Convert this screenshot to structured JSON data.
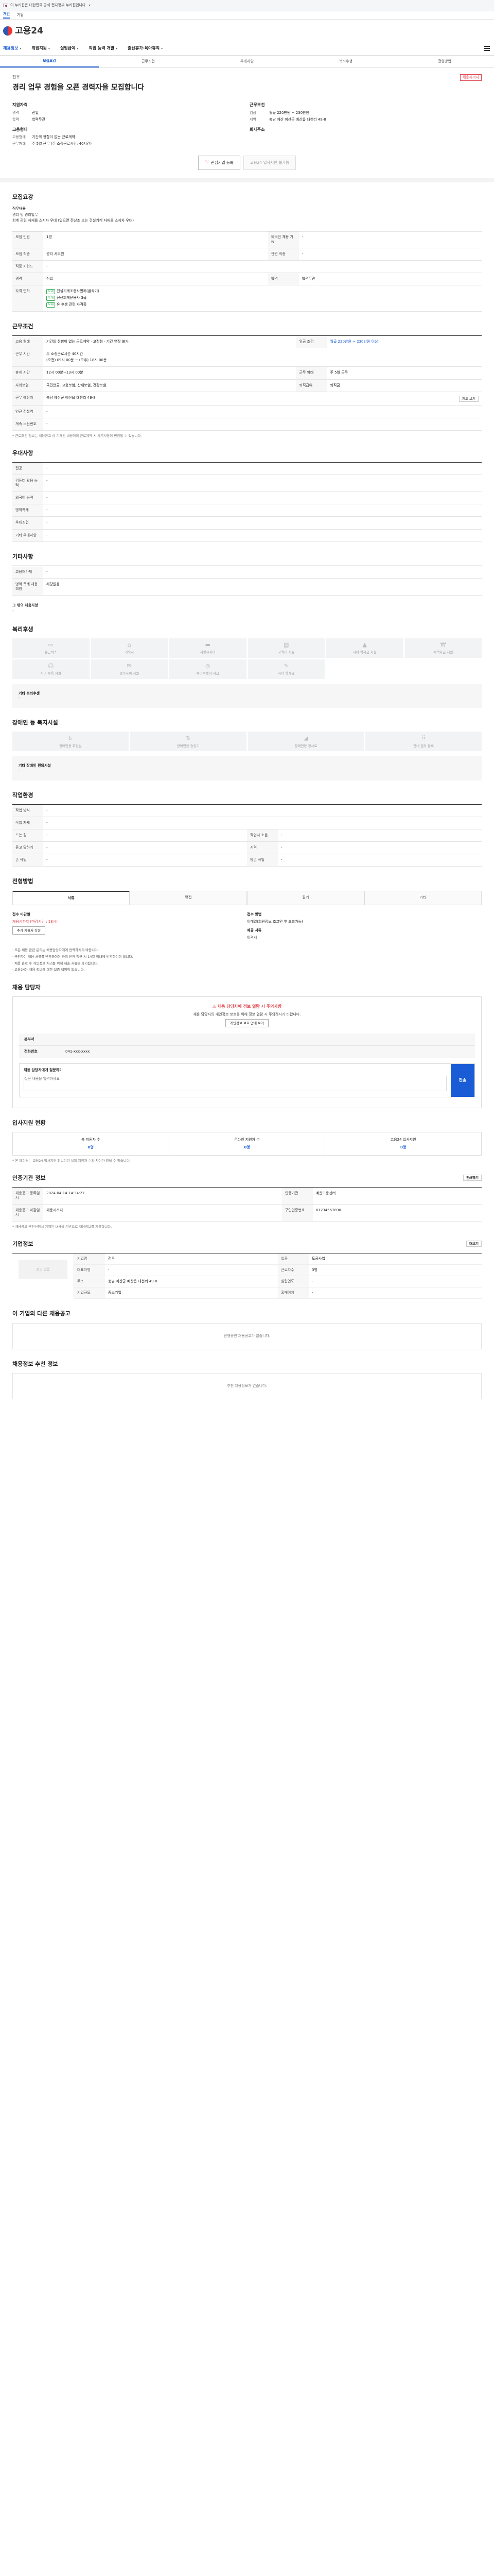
{
  "gov_bar": {
    "text": "이 누리집은 대한민국 공식 전자정부 누리집입니다."
  },
  "sub_bar": {
    "items": [
      "개인",
      "기업"
    ]
  },
  "logo": {
    "text": "고용24"
  },
  "gnb": {
    "items": [
      "채용정보",
      "취업지원",
      "실업급여",
      "직업 능력 개발",
      "출산휴가·육아휴직"
    ]
  },
  "subtabs": {
    "items": [
      "모집요강",
      "근무조건",
      "우대사항",
      "복리후생",
      "전형방법"
    ]
  },
  "company": {
    "name": "전우",
    "hire_badge": "채용시까지"
  },
  "job": {
    "title": "경리 업무 경험을 오픈 경력자을 모집합니다"
  },
  "summary": {
    "left_title": "지원자격",
    "left_rows": [
      {
        "k": "경력",
        "v": "신입"
      },
      {
        "k": "학력",
        "v": "학력무관"
      }
    ],
    "right_title": "근무조건",
    "right_rows": [
      {
        "k": "임금",
        "v": "월급 220만원 ~ 230만원"
      },
      {
        "k": "지역",
        "v": "충남 예산 예산군 예산읍 대천리 49-8"
      }
    ],
    "left2_title": "고용형태",
    "left2_rows": [
      {
        "k": "고용형태",
        "v": "기간의 정함이 없는 근로계약"
      },
      {
        "k": "근무형태",
        "v": "주 5일 근무 (주 소정근로시간: 40시간)"
      }
    ],
    "right2_title": "회사주소",
    "right2_rows": []
  },
  "buttons": {
    "scrap": "관심기업 등록",
    "apply": "고용24 입사지원 불가능"
  },
  "recruit_section": {
    "title": "모집요강",
    "duty_title": "직무내용",
    "duty_lines": [
      "경리 및 경리업무",
      "회계 관련 자재를 소지자 우대 (없으면 전산조 또는 건설기계 자재를 소지자 우대)"
    ],
    "rows": [
      {
        "k1": "모집 인원",
        "v1": "1명",
        "k2": "외국인 채용 가능",
        "v2": "-"
      },
      {
        "k1": "모집 직종",
        "v1": "경리 사무원",
        "k2": "관련 직종",
        "v2": "-"
      },
      {
        "k1": "직종 키워드",
        "v1": "-",
        "k2": "",
        "v2": ""
      },
      {
        "k1": "경력",
        "v1": "신입",
        "k2": "학력",
        "v2": "학력무관"
      },
      {
        "k1": "자격 면허",
        "v1": "",
        "k2": "",
        "v2": ""
      }
    ],
    "licenses": [
      {
        "tag": "우대",
        "text": "건설기계조종사면허(굴삭기)"
      },
      {
        "tag": "우대",
        "text": "전산회계운용사 3급"
      },
      {
        "tag": "우대",
        "text": "유 후생 관련 자격증"
      }
    ]
  },
  "work_section": {
    "title": "근무조건",
    "rows": [
      {
        "k": "고용 형태",
        "v": "기간의 정함이 없는 근로계약 · 고정형 · 기간 연장 불가",
        "k2": "임금 조건",
        "v2": "월급 220만원 ~ 230만원 이상"
      },
      {
        "k": "근무 시간",
        "v": "주 소정근로시간 40시간",
        "k2": "",
        "v2": ""
      },
      {
        "k": "휴게 시간",
        "v": "12시 00분~13시 00분",
        "k2": "근무 형태",
        "v2": "주 5일 근무"
      },
      {
        "k": "사회보험",
        "v": "국민연금, 고용보험, 산재보험, 건강보험",
        "k2": "퇴직급여",
        "v2": "퇴직금"
      },
      {
        "k": "근무 예정지",
        "v": "충남 예산군 예산읍 대천리 49-8",
        "k2": "",
        "v2": ""
      },
      {
        "k": "인근 전철역",
        "v": "-",
        "k2": "",
        "v2": ""
      },
      {
        "k": "계속 노선번호",
        "v": "-",
        "k2": "",
        "v2": ""
      }
    ],
    "time_detail": "(오전) 09시 00분 ~ (오후) 18시 00분",
    "map_btn": "지도 보기",
    "note": "* 근로조건 정보는 채용공고 상 기재된 내용이며 근로계약 시 세부사항이 변경될 수 있습니다."
  },
  "pref_section": {
    "title": "우대사항",
    "rows": [
      {
        "k": "전공",
        "v": "-"
      },
      {
        "k": "컴퓨터 활용 능력",
        "v": "-"
      },
      {
        "k": "외국어 능력",
        "v": "-"
      },
      {
        "k": "병역특례",
        "v": "-"
      },
      {
        "k": "우대조건",
        "v": "-"
      },
      {
        "k": "기타 우대사항",
        "v": "-"
      }
    ]
  },
  "other_section": {
    "title": "기타사항",
    "rows": [
      {
        "k": "고용허가제",
        "v": "-"
      },
      {
        "k": "병역 특례 채용 희망",
        "v": "해당없음"
      }
    ],
    "sub_title": "그 밖의 채용사항",
    "sub_value": "-"
  },
  "benefit_section": {
    "title": "복리후생",
    "cards": [
      "통근버스",
      "기숙사",
      "차량유지비",
      "교육비 지원",
      "자녀 학자금 지원",
      "주택자금 지원",
      "자녀 보육 지원",
      "경조사비 지원",
      "복리후생비 지급",
      "자녀 학자금"
    ],
    "extra_label": "기타 복리후생",
    "extra_value": "-"
  },
  "disability_section": {
    "title": "장애인 등 복지시설",
    "cards": [
      "장애인용 화장실",
      "장애인용 승강기",
      "장애인용 경사로",
      "안내 점자 블록"
    ],
    "extra_label": "기타 장애인 편의시설",
    "extra_value": "-"
  },
  "env_section": {
    "title": "작업환경",
    "rows": [
      {
        "k": "작업 방식",
        "v": "-",
        "k2": "",
        "v2": ""
      },
      {
        "k": "작업 자세",
        "v": "-",
        "k2": "",
        "v2": ""
      },
      {
        "k": "드는 힘",
        "v": "-",
        "k2": "작업시 소음",
        "v2": "-"
      },
      {
        "k": "듣고 말하기",
        "v": "-",
        "k2": "시력",
        "v2": "-"
      },
      {
        "k": "손 작업",
        "v": "-",
        "k2": "양손 작업",
        "v2": "-"
      }
    ]
  },
  "selection_section": {
    "title": "전형방법",
    "tabs": [
      "서류",
      "면접",
      "필기",
      "기타"
    ],
    "col1_title": "접수 마감일",
    "col1_value": "채용시까지 (마감시간 : 18시)",
    "col1_btn": "추가 지원서 작성",
    "col2_title": "접수 방법",
    "col2_value": "이메일(회원정보 조그인 후 조회가능)",
    "col2_sub": "제출 서류",
    "col2_sub_value": "이력서",
    "notes": [
      "· 모든 채용 관련 문의는 채용담당자에게 연락하시기 바랍니다.",
      "· 구인자는 채용 서류를 반환하여야 하며 반환 청구 시 14일 이내에 반환하여야 합니다.",
      "· 채용 완료 후 개인정보 처리를 위해 제출 서류는 파기됩니다.",
      "· 고용24는 채용 정보에 대한 보증 책임이 없습니다."
    ]
  },
  "manager_section": {
    "title": "채용 담당자",
    "alert": "채용 담당자에 정보 열람 시 주의사항",
    "alert_desc": "채용 담당자의 개인정보 보호를 위해 정보 열람 시 주의하시기 바랍니다.",
    "alert_btn": "개인정보 보호 안내 보기",
    "rows": [
      {
        "k": "본부서",
        "v": ""
      },
      {
        "k": "전화번호",
        "v": "041-xxx-xxxx"
      }
    ],
    "inquiry_label": "채용 담당자에게 질문하기",
    "inquiry_placeholder": "질문 내용을 입력하세요",
    "send": "전송"
  },
  "apply_status": {
    "title": "입사지원 현황",
    "cols": [
      {
        "k": "총 지원자 수",
        "v": "0명"
      },
      {
        "k": "온라인 지원자 수",
        "v": "0명"
      },
      {
        "k": "고용24 입사지원",
        "v": "0명"
      }
    ],
    "note": "* 본 데이터는 고용24 입사지원 정보이며 실제 지원자 수와 차이가 있을 수 있습니다."
  },
  "info_section": {
    "title": "인증기관 정보",
    "rows": [
      {
        "k": "채용공고 등록일시",
        "v": "2024-04-14 14:34:27",
        "k2": "인증기관",
        "v2": "예산고용센터"
      },
      {
        "k": "채용공고 마감일시",
        "v": "채용시까지",
        "k2": "구인인증번호",
        "v2": "K1234567890"
      }
    ],
    "print_btn": "인쇄하기",
    "note": "* 채용공고 구인신청서 기재된 내용을 기반으로 채용정보를 제공합니다."
  },
  "company_section": {
    "title": "기업정보",
    "logo_text": "로고 없음",
    "rows": [
      {
        "k": "기업명",
        "v": "전우",
        "k2": "업종",
        "v2": "토공사업"
      },
      {
        "k": "대표자명",
        "v": "-",
        "k2": "근로자수",
        "v2": "3명"
      },
      {
        "k": "주소",
        "v": "충남 예산군 예산읍 대천리 49-8",
        "k2": "설립연도",
        "v2": "-"
      },
      {
        "k": "기업규모",
        "v": "중소기업",
        "k2": "홈페이지",
        "v2": "-"
      }
    ],
    "more_btn": "더보기"
  },
  "other_jobs": {
    "title": "이 기업의 다른 채용공고",
    "empty": "진행중인 채용공고가 없습니다."
  },
  "similar_jobs": {
    "title": "채용정보 추천 정보",
    "empty": "추천 채용정보가 없습니다."
  },
  "colors": {
    "brand": "#1a5bd6",
    "accent": "#e0444c",
    "tag_green": "#2fa84f"
  }
}
